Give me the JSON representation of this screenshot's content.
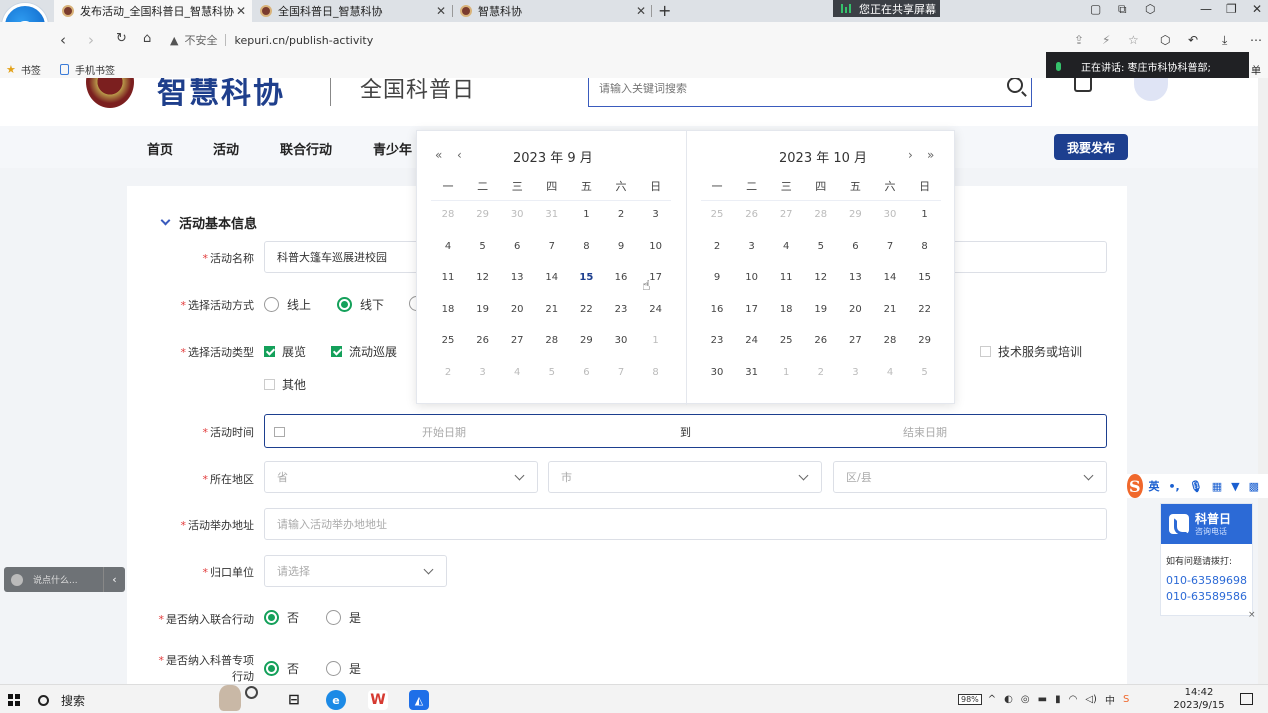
{
  "browser": {
    "tabs": [
      {
        "title": "发布活动_全国科普日_智慧科协",
        "active": true
      },
      {
        "title": "全国科普日_智慧科协",
        "active": false
      },
      {
        "title": "智慧科协",
        "active": false
      }
    ],
    "screen_share_notice": "您正在共享屏幕",
    "security_label": "不安全",
    "url": "kepuri.cn/publish-activity",
    "bookmarks": [
      "书签",
      "手机书签"
    ],
    "speaking_notice": "正在讲话:  枣庄市科协科普部;",
    "speaking_overflow": "单"
  },
  "site": {
    "name": "智慧科协",
    "subtitle": "全国科普日",
    "search_placeholder": "请输入关键词搜索",
    "nav": [
      "首页",
      "活动",
      "联合行动",
      "青少年"
    ],
    "publish_button": "我要发布"
  },
  "form": {
    "section_title": "活动基本信息",
    "activity_name": {
      "label": "活动名称",
      "value": "科普大篷车巡展进校园"
    },
    "activity_mode": {
      "label": "选择活动方式",
      "options": [
        {
          "label": "线上",
          "selected": false
        },
        {
          "label": "线下",
          "selected": true
        }
      ]
    },
    "activity_type": {
      "label": "选择活动类型",
      "options": [
        {
          "label": "展览",
          "checked": true
        },
        {
          "label": "流动巡展",
          "checked": true
        },
        {
          "label": "技术服务或培训",
          "checked": false
        },
        {
          "label": "其他",
          "checked": false
        }
      ]
    },
    "activity_time": {
      "label": "活动时间",
      "start_placeholder": "开始日期",
      "separator": "到",
      "end_placeholder": "结束日期"
    },
    "region": {
      "label": "所在地区",
      "province": "省",
      "city": "市",
      "district": "区/县"
    },
    "address": {
      "label": "活动举办地址",
      "placeholder": "请输入活动举办地地址"
    },
    "department": {
      "label": "归口单位",
      "placeholder": "请选择"
    },
    "joint_action": {
      "label": "是否纳入联合行动",
      "options": [
        {
          "label": "否",
          "selected": true
        },
        {
          "label": "是",
          "selected": false
        }
      ]
    },
    "special_action": {
      "label_line1": "是否纳入科普专项",
      "label_line2": "行动",
      "options": [
        {
          "label": "否",
          "selected": true
        },
        {
          "label": "是",
          "selected": false
        }
      ]
    }
  },
  "date_picker": {
    "nav": {
      "prev_year": "«",
      "prev_month": "‹",
      "next_month": "›",
      "next_year": "»"
    },
    "weekdays": [
      "一",
      "二",
      "三",
      "四",
      "五",
      "六",
      "日"
    ],
    "months": [
      {
        "title": "2023 年 9 月",
        "weeks": [
          [
            "28",
            "29",
            "30",
            "31",
            "1",
            "2",
            "3"
          ],
          [
            "4",
            "5",
            "6",
            "7",
            "8",
            "9",
            "10"
          ],
          [
            "11",
            "12",
            "13",
            "14",
            "15",
            "16",
            "17"
          ],
          [
            "18",
            "19",
            "20",
            "21",
            "22",
            "23",
            "24"
          ],
          [
            "25",
            "26",
            "27",
            "28",
            "29",
            "30",
            "1"
          ],
          [
            "2",
            "3",
            "4",
            "5",
            "6",
            "7",
            "8"
          ]
        ],
        "first_current_index": 4,
        "last_current_index": 33,
        "today_index": 18
      },
      {
        "title": "2023 年 10 月",
        "weeks": [
          [
            "25",
            "26",
            "27",
            "28",
            "29",
            "30",
            "1"
          ],
          [
            "2",
            "3",
            "4",
            "5",
            "6",
            "7",
            "8"
          ],
          [
            "9",
            "10",
            "11",
            "12",
            "13",
            "14",
            "15"
          ],
          [
            "16",
            "17",
            "18",
            "19",
            "20",
            "21",
            "22"
          ],
          [
            "23",
            "24",
            "25",
            "26",
            "27",
            "28",
            "29"
          ],
          [
            "30",
            "31",
            "1",
            "2",
            "3",
            "4",
            "5"
          ]
        ],
        "first_current_index": 6,
        "last_current_index": 36,
        "today_index": -1
      }
    ]
  },
  "widgets": {
    "chat_placeholder": "说点什么...",
    "chat_collapse": "‹",
    "ime_label": "英",
    "hotline": {
      "title": "科普日",
      "subtitle": "咨询电话",
      "tip": "如有问题请拨打:",
      "numbers": [
        "010-63589698",
        "010-63589586"
      ],
      "close": "×"
    }
  },
  "taskbar": {
    "search_label": "搜索",
    "battery": "98%",
    "time": "14:42",
    "date": "2023/9/15"
  },
  "colors": {
    "primary": "#1d3f8f",
    "accent_green": "#14a05a",
    "required": "#e23b3b"
  }
}
